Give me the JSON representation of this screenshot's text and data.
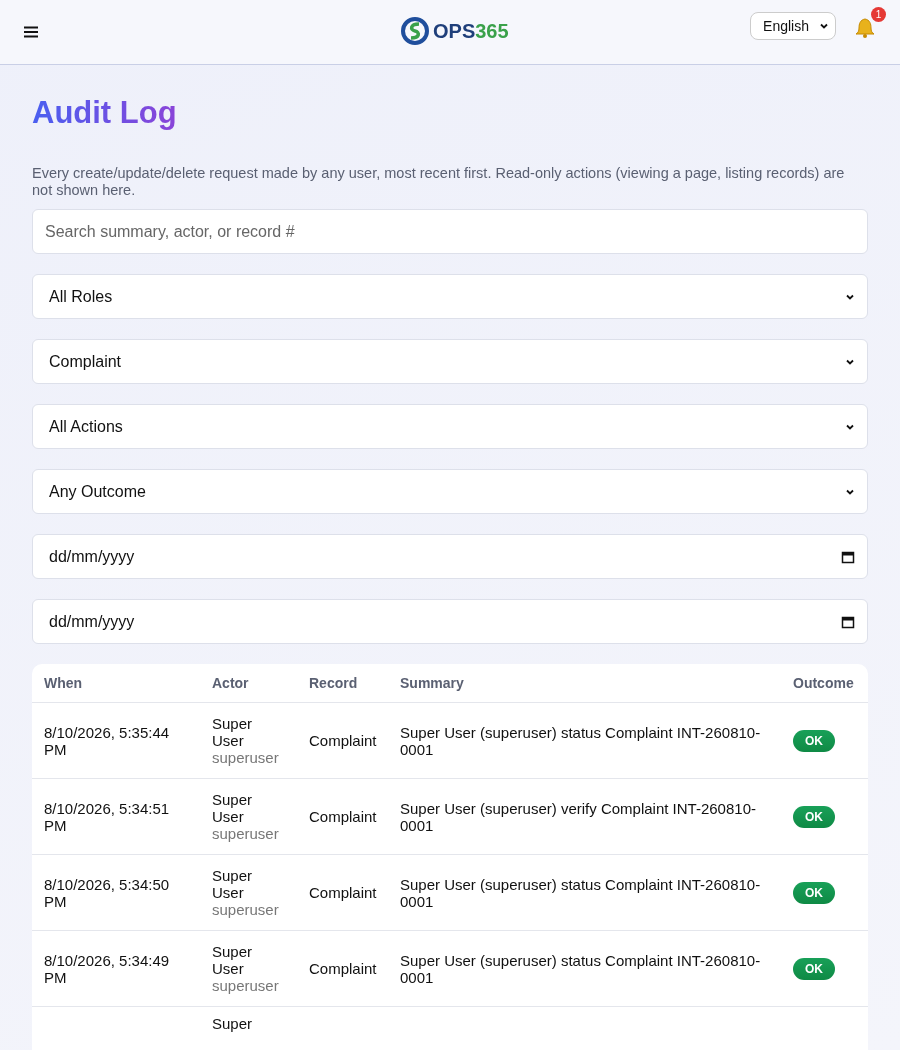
{
  "header": {
    "logo": {
      "prefix": "OPS",
      "suffix": "365"
    },
    "language": "English",
    "notifications": "1"
  },
  "title": "Audit Log",
  "description": "Every create/update/delete request made by any user, most recent first. Read-only actions (viewing a page, listing records) are not shown here.",
  "search": {
    "placeholder": "Search summary, actor, or record #"
  },
  "filters": [
    {
      "kind": "select",
      "value": "All Roles"
    },
    {
      "kind": "select",
      "value": "Complaint"
    },
    {
      "kind": "select",
      "value": "All Actions"
    },
    {
      "kind": "select",
      "value": "Any Outcome"
    },
    {
      "kind": "date",
      "value": "dd/mm/yyyy"
    },
    {
      "kind": "date",
      "value": "dd/mm/yyyy"
    }
  ],
  "table": {
    "columns": [
      "When",
      "Actor",
      "Record",
      "Summary",
      "Outcome"
    ],
    "rows": [
      {
        "when": "8/10/2026, 5:35:44 PM",
        "actor_name": "Super User",
        "actor_username": "superuser",
        "record": "Complaint",
        "summary": "Super User (superuser) status Complaint INT-260810-0001",
        "outcome": "OK"
      },
      {
        "when": "8/10/2026, 5:34:51 PM",
        "actor_name": "Super User",
        "actor_username": "superuser",
        "record": "Complaint",
        "summary": "Super User (superuser) verify Complaint INT-260810-0001",
        "outcome": "OK"
      },
      {
        "when": "8/10/2026, 5:34:50 PM",
        "actor_name": "Super User",
        "actor_username": "superuser",
        "record": "Complaint",
        "summary": "Super User (superuser) status Complaint INT-260810-0001",
        "outcome": "OK"
      },
      {
        "when": "8/10/2026, 5:34:49 PM",
        "actor_name": "Super User",
        "actor_username": "superuser",
        "record": "Complaint",
        "summary": "Super User (superuser) status Complaint INT-260810-0001",
        "outcome": "OK"
      },
      {
        "actor_name": "Super"
      }
    ]
  }
}
